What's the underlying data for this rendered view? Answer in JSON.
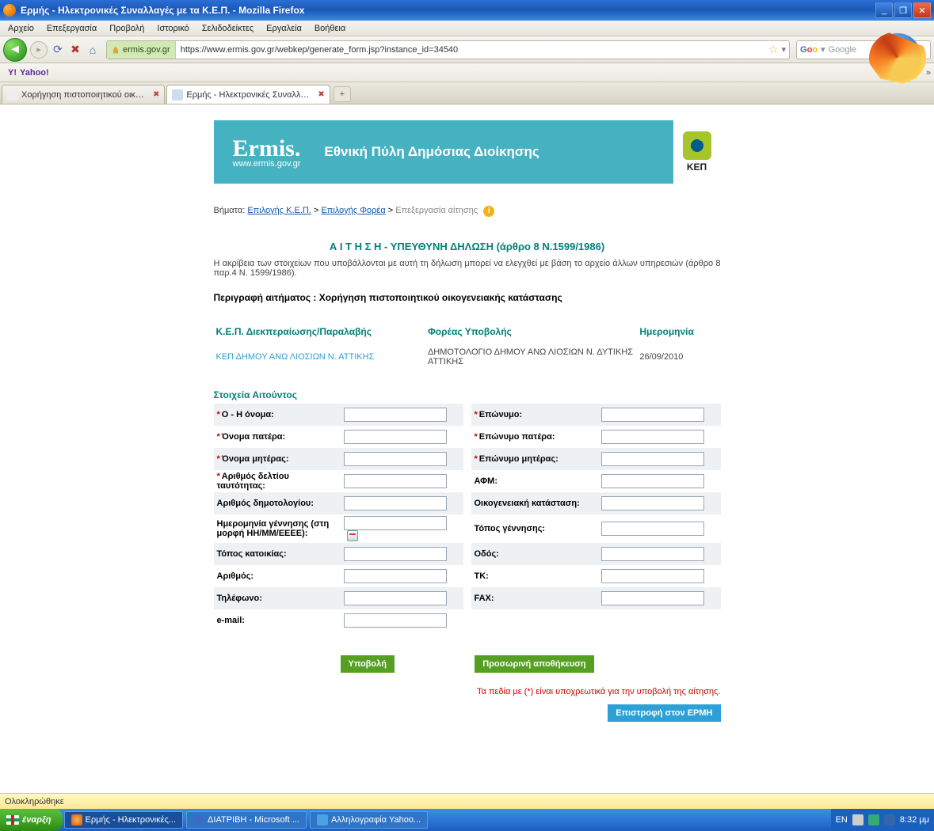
{
  "window": {
    "title": "Ερμής - Ηλεκτρονικές Συναλλαγές με τα Κ.Ε.Π. - Mozilla Firefox"
  },
  "menu": {
    "file": "Αρχείο",
    "edit": "Επεξεργασία",
    "view": "Προβολή",
    "history": "Ιστορικό",
    "bookmarks": "Σελιδοδείκτες",
    "tools": "Εργαλεία",
    "help": "Βοήθεια"
  },
  "url": {
    "site": "ermis.gov.gr",
    "full": "https://www.ermis.gov.gr/webkep/generate_form.jsp?instance_id=34540"
  },
  "search": {
    "placeholder": "Google"
  },
  "bookmark": {
    "yahoo": "Yahoo!"
  },
  "tabs": {
    "t1": "Χορήγηση πιστοποιητικού οικογενειακή...",
    "t2": "Ερμής - Ηλεκτρονικές Συναλλαγέ..."
  },
  "banner": {
    "logo1": "Ermis.",
    "logo2": "www.ermis.gov.gr",
    "title": "Εθνική Πύλη Δημόσιας Διοίκησης",
    "kep": "ΚΕΠ"
  },
  "crumb": {
    "label": "Βήματα:",
    "s1": "Επιλογής Κ.Ε.Π.",
    "s2": "Επιλογής Φορέα",
    "s3": "Επεξεργασία αίτησης"
  },
  "heading": {
    "title": "Α Ι Τ Η Σ Η - ΥΠΕΥΘΥΝΗ ΔΗΛΩΣΗ (άρθρο 8 Ν.1599/1986)",
    "note": "Η ακρίβεια των στοιχείων που υποβάλλονται με αυτή τη δήλωση μπορεί να ελεγχθεί με βάση το αρχείο άλλων υπηρεσιών (άρθρο 8 παρ.4 Ν. 1599/1986).",
    "req_desc": "Περιγραφή αιτήματος : Χορήγηση πιστοποιητικού οικογενειακής κατάστασης"
  },
  "info": {
    "h1": "Κ.Ε.Π. Διεκπεραίωσης/Παραλαβής",
    "h2": "Φορέας Υποβολής",
    "h3": "Ημερομηνία",
    "v1": "ΚΕΠ ΔΗΜΟΥ ΑΝΩ ΛΙΟΣΙΩΝ Ν. ΑΤΤΙΚΗΣ",
    "v2": "ΔΗΜΟΤΟΛΟΓΙΟ ΔΗΜΟΥ ΑΝΩ ΛΙΟΣΙΩΝ Ν. ΔΥΤΙΚΗΣ ΑΤΤΙΚΗΣ",
    "v3": "26/09/2010"
  },
  "applicant": {
    "title": "Στοιχεία Αιτούντος"
  },
  "fields": {
    "first_last": "Ο - Η όνομα:",
    "surname": "Επώνυμο:",
    "father_name": "Όνομα πατέρα:",
    "father_surname": "Επώνυμο πατέρα:",
    "mother_name": "Όνομα μητέρας:",
    "mother_surname": "Επώνυμο μητέρας:",
    "id_num": "Αριθμός δελτίου ταυτότητας:",
    "afm": "ΑΦΜ:",
    "muni_num": "Αριθμός δημοτολογίου:",
    "family_status": "Οικογενειακή κατάσταση:",
    "dob": "Ημερομηνία γέννησης (στη μορφή ΗΗ/ΜΜ/ΕΕΕΕ):",
    "birth_place": "Τόπος γέννησης:",
    "res_place": "Τόπος κατοικίας:",
    "street": "Οδός:",
    "num": "Αριθμός:",
    "tk": "ΤΚ:",
    "phone": "Τηλέφωνο:",
    "fax": "FAX:",
    "email": "e-mail:"
  },
  "buttons": {
    "submit": "Υποβολή",
    "save": "Προσωρινή αποθήκευση",
    "back": "Επιστροφή στον ΕΡΜΗ"
  },
  "mand": "Τα πεδία με (*) είναι υποχρεωτικά για την υποβολή της αίτησης.",
  "status": {
    "text": "Ολοκληρώθηκε"
  },
  "taskbar": {
    "start": "έναρξη",
    "t1": "Ερμής - Ηλεκτρονικές...",
    "t2": "ΔΙΑΤΡΙΒΗ - Microsoft ...",
    "t3": "Αλληλογραφία Yahoo...",
    "lang": "EN",
    "time": "8:32 μμ"
  }
}
